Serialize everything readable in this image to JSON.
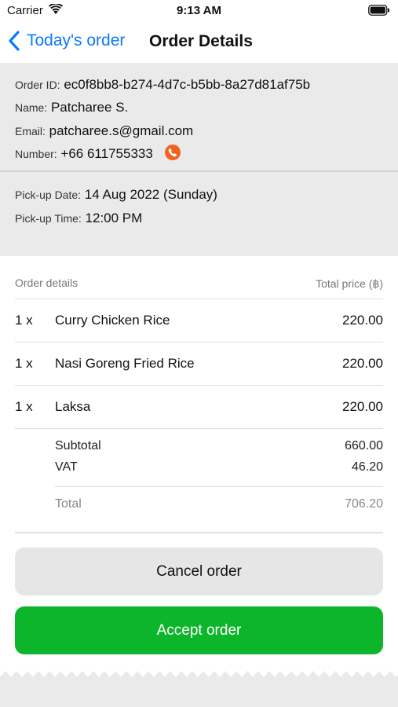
{
  "status_bar": {
    "carrier": "Carrier",
    "time": "9:13 AM"
  },
  "nav": {
    "back_label": "Today's order",
    "title": "Order Details"
  },
  "customer": {
    "order_id_label": "Order ID:",
    "order_id": "ec0f8bb8-b274-4d7c-b5bb-8a27d81af75b",
    "name_label": "Name:",
    "name": "Patcharee S.",
    "email_label": "Email:",
    "email": "patcharee.s@gmail.com",
    "number_label": "Number:",
    "number": "+66 611755333"
  },
  "pickup": {
    "date_label": "Pick-up Date:",
    "date": "14 Aug 2022 (Sunday)",
    "time_label": "Pick-up Time:",
    "time": "12:00 PM"
  },
  "order": {
    "header_left": "Order details",
    "header_right": "Total price (฿)",
    "items": [
      {
        "qty": "1 x",
        "name": "Curry Chicken Rice",
        "price": "220.00"
      },
      {
        "qty": "1 x",
        "name": "Nasi Goreng Fried Rice",
        "price": "220.00"
      },
      {
        "qty": "1 x",
        "name": "Laksa",
        "price": "220.00"
      }
    ],
    "subtotal_label": "Subtotal",
    "subtotal": "660.00",
    "vat_label": "VAT",
    "vat": "46.20",
    "total_label": "Total",
    "total": "706.20"
  },
  "actions": {
    "cancel_label": "Cancel order",
    "accept_label": "Accept order"
  },
  "colors": {
    "accent": "#0a7aff",
    "accept": "#0db52a",
    "phone": "#f2631f",
    "section_bg": "#eaeaea"
  }
}
